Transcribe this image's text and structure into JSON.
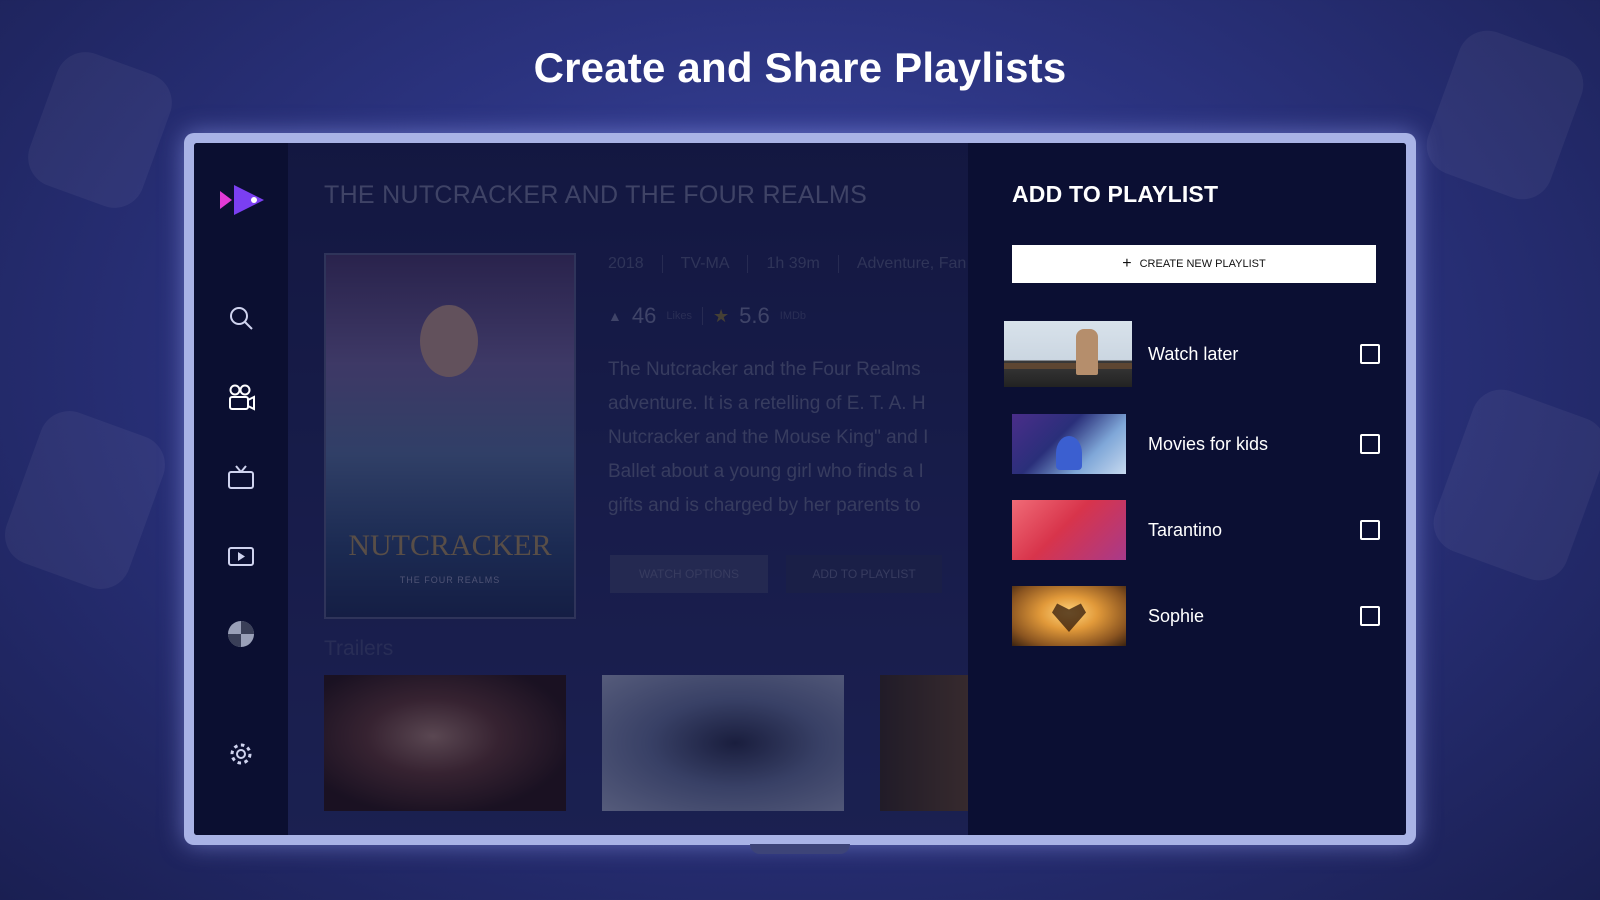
{
  "headline": "Create and Share Playlists",
  "sidebar": {
    "items": [
      {
        "icon": "search-icon"
      },
      {
        "icon": "movies-icon"
      },
      {
        "icon": "tv-icon"
      },
      {
        "icon": "live-tv-icon"
      },
      {
        "icon": "sports-icon"
      },
      {
        "icon": "gear-icon"
      }
    ]
  },
  "movie": {
    "title": "THE NUTCRACKER AND THE FOUR REALMS",
    "poster_title": "NUTCRACKER",
    "poster_subtitle": "THE FOUR REALMS",
    "year": "2018",
    "rating": "TV-MA",
    "duration": "1h 39m",
    "genres": "Adventure, Fan",
    "likes": "46",
    "likes_caption": "Likes",
    "score": "5.6",
    "score_caption": "IMDb",
    "description_lines": [
      "The Nutcracker and the Four Realms",
      "adventure. It is a retelling of E. T. A. H",
      "Nutcracker and the Mouse King\" and I",
      "Ballet about a young girl who finds a I",
      "gifts and is charged by her parents to"
    ],
    "watch_options_label": "WATCH OPTIONS",
    "add_to_playlist_label": "ADD TO PLAYLIST",
    "trailers_label": "Trailers"
  },
  "panel": {
    "title": "ADD TO PLAYLIST",
    "create_label": "CREATE NEW PLAYLIST",
    "playlists": [
      {
        "name": "Watch later",
        "checked": false
      },
      {
        "name": "Movies for kids",
        "checked": false
      },
      {
        "name": "Tarantino",
        "checked": false
      },
      {
        "name": "Sophie",
        "checked": false
      }
    ]
  },
  "colors": {
    "accent": "#7b3ff2",
    "accent_pink": "#e23ad6",
    "panel_bg": "#0b0f33"
  }
}
